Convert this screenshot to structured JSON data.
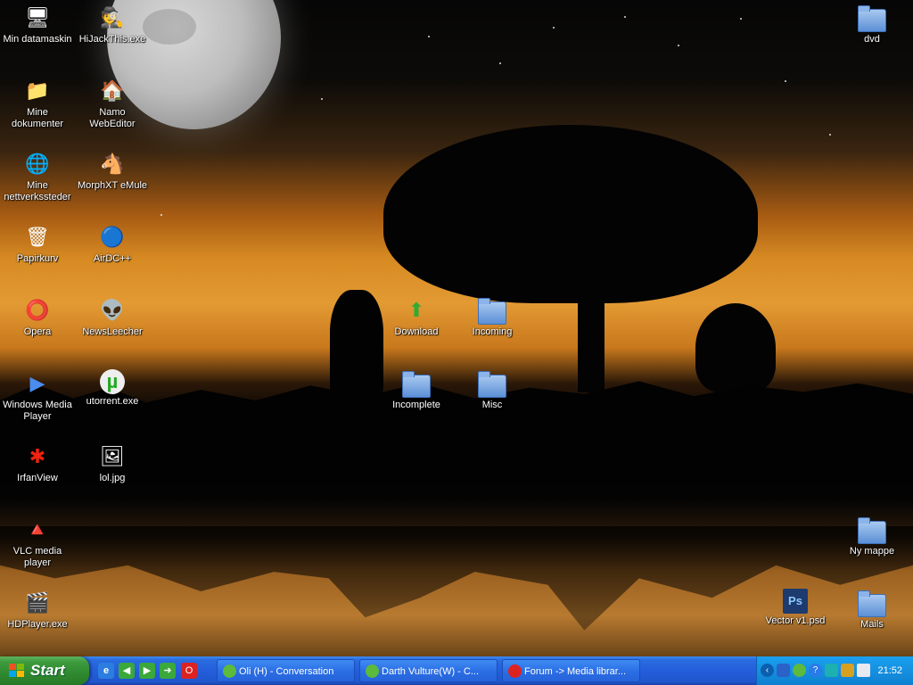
{
  "desktop": {
    "icons": [
      {
        "label": "Min datamaskin",
        "icon": "computer-icon",
        "glyph": "🖥"
      },
      {
        "label": "HiJackThis.exe",
        "icon": "hijackthis-icon",
        "glyph": "🕵"
      },
      {
        "label": "Mine dokumenter",
        "icon": "documents-folder-icon",
        "glyph": "📁"
      },
      {
        "label": "Namo WebEditor",
        "icon": "namo-webeditor-icon",
        "glyph": "🏠"
      },
      {
        "label": "Mine nettverkssteder",
        "icon": "network-places-icon",
        "glyph": "🌐"
      },
      {
        "label": "MorphXT eMule",
        "icon": "emule-icon",
        "glyph": "🐴"
      },
      {
        "label": "Papirkurv",
        "icon": "recycle-bin-icon",
        "glyph": "🗑"
      },
      {
        "label": "AirDC++",
        "icon": "airdc-icon",
        "glyph": "🔵"
      },
      {
        "label": "Opera",
        "icon": "opera-icon",
        "glyph": "⭕"
      },
      {
        "label": "NewsLeecher",
        "icon": "newsleecher-icon",
        "glyph": "👽"
      },
      {
        "label": "Download",
        "icon": "download-folder-icon",
        "glyph": "⬆"
      },
      {
        "label": "Incoming",
        "icon": "folder-icon",
        "glyph": ""
      },
      {
        "label": "Windows Media Player",
        "icon": "media-player-icon",
        "glyph": "▶"
      },
      {
        "label": "utorrent.exe",
        "icon": "utorrent-icon",
        "glyph": "µ"
      },
      {
        "label": "Incomplete",
        "icon": "folder-icon",
        "glyph": ""
      },
      {
        "label": "Misc",
        "icon": "folder-icon",
        "glyph": ""
      },
      {
        "label": "IrfanView",
        "icon": "irfanview-icon",
        "glyph": "✱"
      },
      {
        "label": "lol.jpg",
        "icon": "jpg-file-icon",
        "glyph": "🖼"
      },
      {
        "label": "VLC media player",
        "icon": "vlc-icon",
        "glyph": "🔺"
      },
      {
        "label": "HDPlayer.exe",
        "icon": "hdplayer-icon",
        "glyph": "🎬"
      },
      {
        "label": "dvd",
        "icon": "folder-icon",
        "glyph": ""
      },
      {
        "label": "Ny mappe",
        "icon": "folder-icon",
        "glyph": ""
      },
      {
        "label": "Vector v1.psd",
        "icon": "psd-file-icon",
        "glyph": "Ps"
      },
      {
        "label": "Mails",
        "icon": "folder-icon",
        "glyph": ""
      }
    ]
  },
  "taskbar": {
    "start_label": "Start",
    "quick_launch": [
      {
        "icon": "ie-icon"
      },
      {
        "icon": "back-arrow-icon"
      },
      {
        "icon": "play-icon"
      },
      {
        "icon": "forward-arrow-icon"
      },
      {
        "icon": "opera-small-icon"
      }
    ],
    "tasks": [
      {
        "label": "Oli (H) - Conversation",
        "icon": "msn-icon"
      },
      {
        "label": "Darth Vulture(W) - C...",
        "icon": "msn-icon"
      },
      {
        "label": "Forum -> Media librar...",
        "icon": "opera-small-icon"
      }
    ],
    "tray": {
      "icons": [
        "tray-collapse-icon",
        "shield-icon",
        "msn-tray-icon",
        "help-icon",
        "network-icon",
        "lock-icon",
        "mail-icon"
      ],
      "clock": "21:52"
    }
  },
  "colors": {
    "taskbar_blue": "#245edb",
    "start_green": "#3c9a3c",
    "tray_blue": "#1590e0"
  }
}
